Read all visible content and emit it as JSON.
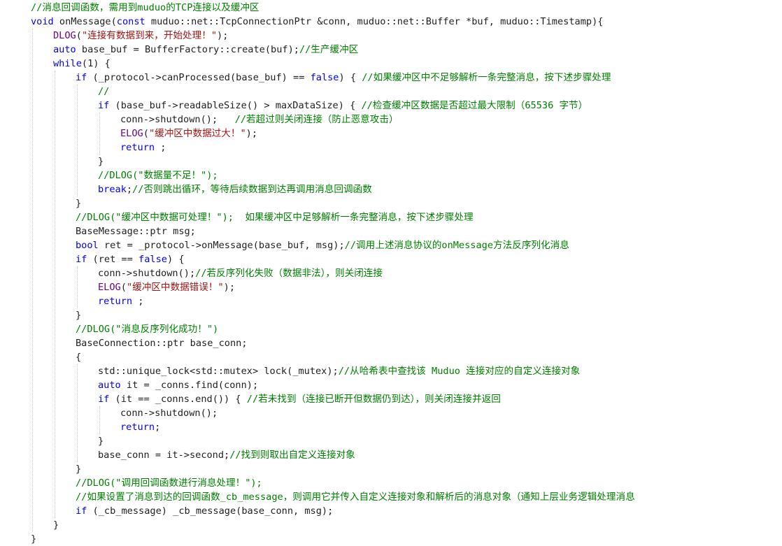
{
  "code": {
    "lines": [
      {
        "indent": 0,
        "tokens": [
          {
            "t": "//消息回调函数，需用到muduo的TCP连接以及缓冲区",
            "c": "cmt"
          }
        ]
      },
      {
        "indent": 0,
        "tokens": [
          {
            "t": "void",
            "c": "kw"
          },
          {
            "t": " onMessage(",
            "c": "plain"
          },
          {
            "t": "const",
            "c": "kw"
          },
          {
            "t": " muduo::net::TcpConnectionPtr &conn, muduo::net::Buffer *buf, muduo::Timestamp){",
            "c": "plain"
          }
        ]
      },
      {
        "indent": 1,
        "tokens": [
          {
            "t": "DLOG",
            "c": "mac"
          },
          {
            "t": "(",
            "c": "plain"
          },
          {
            "t": "\"连接有数据到来，开始处理！\"",
            "c": "str"
          },
          {
            "t": ");",
            "c": "plain"
          }
        ]
      },
      {
        "indent": 1,
        "tokens": [
          {
            "t": "auto",
            "c": "kw"
          },
          {
            "t": " base_buf = BufferFactory::create(buf);",
            "c": "plain"
          },
          {
            "t": "//生产缓冲区",
            "c": "cmt"
          }
        ]
      },
      {
        "indent": 1,
        "tokens": [
          {
            "t": "while",
            "c": "kw"
          },
          {
            "t": "(1) {",
            "c": "plain"
          }
        ]
      },
      {
        "indent": 2,
        "tokens": [
          {
            "t": "if",
            "c": "kw"
          },
          {
            "t": " (_protocol->canProcessed(base_buf) == ",
            "c": "plain"
          },
          {
            "t": "false",
            "c": "kw"
          },
          {
            "t": ") { ",
            "c": "plain"
          },
          {
            "t": "//如果缓冲区中不足够解析一条完整消息，按下述步骤处理",
            "c": "cmt"
          }
        ]
      },
      {
        "indent": 3,
        "tokens": [
          {
            "t": "//",
            "c": "cmt"
          }
        ]
      },
      {
        "indent": 3,
        "tokens": [
          {
            "t": "if",
            "c": "kw"
          },
          {
            "t": " (base_buf->readableSize() > maxDataSize) { ",
            "c": "plain"
          },
          {
            "t": "//检查缓冲区数据是否超过最大限制（65536 字节）",
            "c": "cmt"
          }
        ]
      },
      {
        "indent": 4,
        "tokens": [
          {
            "t": "conn->shutdown();   ",
            "c": "plain"
          },
          {
            "t": "//若超过则关闭连接（防止恶意攻击）",
            "c": "cmt"
          }
        ]
      },
      {
        "indent": 4,
        "tokens": [
          {
            "t": "ELOG",
            "c": "mac"
          },
          {
            "t": "(",
            "c": "plain"
          },
          {
            "t": "\"缓冲区中数据过大！\"",
            "c": "str"
          },
          {
            "t": ");",
            "c": "plain"
          }
        ]
      },
      {
        "indent": 4,
        "tokens": [
          {
            "t": "return",
            "c": "kw"
          },
          {
            "t": " ;",
            "c": "plain"
          }
        ]
      },
      {
        "indent": 3,
        "tokens": [
          {
            "t": "}",
            "c": "plain"
          }
        ]
      },
      {
        "indent": 3,
        "tokens": [
          {
            "t": "//DLOG(\"数据量不足！\");",
            "c": "cmt"
          }
        ]
      },
      {
        "indent": 3,
        "tokens": [
          {
            "t": "break",
            "c": "kw"
          },
          {
            "t": ";",
            "c": "plain"
          },
          {
            "t": "//否则跳出循环，等待后续数据到达再调用消息回调函数",
            "c": "cmt"
          }
        ]
      },
      {
        "indent": 2,
        "tokens": [
          {
            "t": "}",
            "c": "plain"
          }
        ]
      },
      {
        "indent": 2,
        "tokens": [
          {
            "t": "//DLOG(\"缓冲区中数据可处理！\");  如果缓冲区中足够解析一条完整消息，按下述步骤处理",
            "c": "cmt"
          }
        ]
      },
      {
        "indent": 2,
        "tokens": [
          {
            "t": "BaseMessage::ptr msg;",
            "c": "plain"
          }
        ]
      },
      {
        "indent": 2,
        "tokens": [
          {
            "t": "bool",
            "c": "kw"
          },
          {
            "t": " ret = _protocol->onMessage(base_buf, msg);",
            "c": "plain"
          },
          {
            "t": "//调用上述消息协议的onMessage方法反序列化消息",
            "c": "cmt"
          }
        ]
      },
      {
        "indent": 2,
        "tokens": [
          {
            "t": "if",
            "c": "kw"
          },
          {
            "t": " (ret == ",
            "c": "plain"
          },
          {
            "t": "false",
            "c": "kw"
          },
          {
            "t": ") {",
            "c": "plain"
          }
        ]
      },
      {
        "indent": 3,
        "tokens": [
          {
            "t": "conn->shutdown();",
            "c": "plain"
          },
          {
            "t": "//若反序列化失败（数据非法），则关闭连接",
            "c": "cmt"
          }
        ]
      },
      {
        "indent": 3,
        "tokens": [
          {
            "t": "ELOG",
            "c": "mac"
          },
          {
            "t": "(",
            "c": "plain"
          },
          {
            "t": "\"缓冲区中数据错误！\"",
            "c": "str"
          },
          {
            "t": ");",
            "c": "plain"
          }
        ]
      },
      {
        "indent": 3,
        "tokens": [
          {
            "t": "return",
            "c": "kw"
          },
          {
            "t": " ;",
            "c": "plain"
          }
        ]
      },
      {
        "indent": 2,
        "tokens": [
          {
            "t": "}",
            "c": "plain"
          }
        ]
      },
      {
        "indent": 2,
        "tokens": [
          {
            "t": "//DLOG(\"消息反序列化成功！\")",
            "c": "cmt"
          }
        ]
      },
      {
        "indent": 2,
        "tokens": [
          {
            "t": "BaseConnection::ptr base_conn;",
            "c": "plain"
          }
        ]
      },
      {
        "indent": 2,
        "tokens": [
          {
            "t": "{",
            "c": "plain"
          }
        ]
      },
      {
        "indent": 3,
        "tokens": [
          {
            "t": "std::unique_lock<std::mutex> lock(_mutex);",
            "c": "plain"
          },
          {
            "t": "//从哈希表中查找该 Muduo 连接对应的自定义连接对象",
            "c": "cmt"
          }
        ]
      },
      {
        "indent": 3,
        "tokens": [
          {
            "t": "auto",
            "c": "kw"
          },
          {
            "t": " it = _conns.find(conn);",
            "c": "plain"
          }
        ]
      },
      {
        "indent": 3,
        "tokens": [
          {
            "t": "if",
            "c": "kw"
          },
          {
            "t": " (it == _conns.end()) { ",
            "c": "plain"
          },
          {
            "t": "//若未找到（连接已断开但数据仍到达），则关闭连接并返回",
            "c": "cmt"
          }
        ]
      },
      {
        "indent": 4,
        "tokens": [
          {
            "t": "conn->shutdown();",
            "c": "plain"
          }
        ]
      },
      {
        "indent": 4,
        "tokens": [
          {
            "t": "return",
            "c": "kw"
          },
          {
            "t": ";",
            "c": "plain"
          }
        ]
      },
      {
        "indent": 3,
        "tokens": [
          {
            "t": "}",
            "c": "plain"
          }
        ]
      },
      {
        "indent": 3,
        "tokens": [
          {
            "t": "base_conn = it->second;",
            "c": "plain"
          },
          {
            "t": "//找到则取出自定义连接对象",
            "c": "cmt"
          }
        ]
      },
      {
        "indent": 2,
        "tokens": [
          {
            "t": "}",
            "c": "plain"
          }
        ]
      },
      {
        "indent": 2,
        "tokens": [
          {
            "t": "//DLOG(\"调用回调函数进行消息处理！\");",
            "c": "cmt"
          }
        ]
      },
      {
        "indent": 2,
        "tokens": [
          {
            "t": "//如果设置了消息到达的回调函数_cb_message，则调用它并传入自定义连接对象和解析后的消息对象（通知上层业务逻辑处理消息",
            "c": "cmt"
          }
        ]
      },
      {
        "indent": 2,
        "tokens": [
          {
            "t": "if",
            "c": "kw"
          },
          {
            "t": " (_cb_message) _cb_message(base_conn, msg);",
            "c": "plain"
          }
        ]
      },
      {
        "indent": 1,
        "tokens": [
          {
            "t": "}",
            "c": "plain"
          }
        ]
      },
      {
        "indent": 0,
        "tokens": [
          {
            "t": "}",
            "c": "plain"
          }
        ]
      }
    ]
  },
  "colors": {
    "plain": "#1f1f1f",
    "keyword": "#0000ff",
    "string": "#a31515",
    "comment": "#008000",
    "macro": "#6f008a",
    "indent_guide": "#c8c8c8",
    "background": "#ffffff"
  }
}
